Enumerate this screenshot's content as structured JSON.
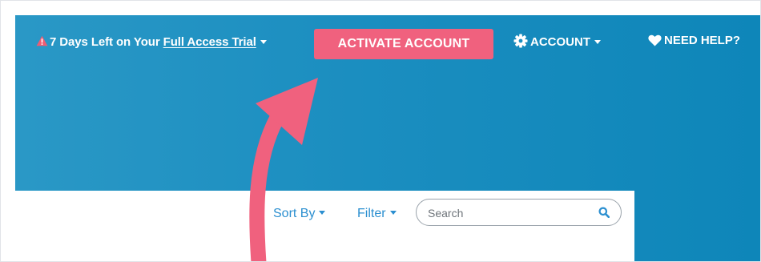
{
  "header": {
    "trial_prefix": "7 Days Left on Your",
    "trial_link": "Full Access Trial",
    "activate_label": "ACTIVATE ACCOUNT",
    "account_label": "ACCOUNT",
    "help_label": "NEED HELP?"
  },
  "toolbar": {
    "sort_label": "Sort By",
    "filter_label": "Filter",
    "search_placeholder": "Search"
  },
  "colors": {
    "hero_blue": "#1b8ec0",
    "accent_pink": "#f0617e",
    "link_blue": "#2b8fd0",
    "warning_red": "#ef5c73",
    "white": "#ffffff"
  },
  "icons": {
    "trial": "warning-triangle-icon",
    "account": "gear-icon",
    "help": "heart-icon",
    "search": "search-icon",
    "annotation": "curved-arrow-icon"
  }
}
